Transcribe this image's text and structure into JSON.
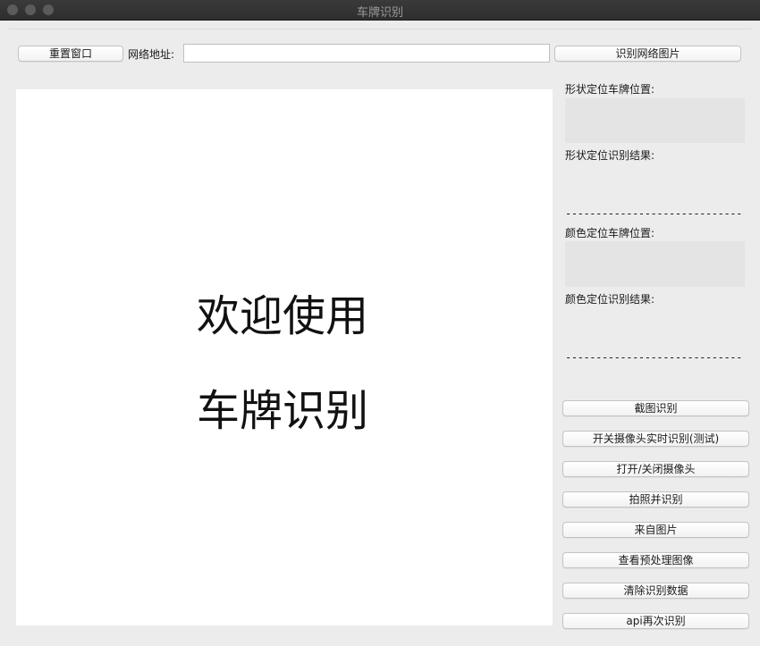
{
  "window": {
    "title": "车牌识别"
  },
  "toolbar": {
    "reset_label": "重置窗口",
    "url_label": "网络地址:",
    "url_value": "",
    "recognize_url_label": "识别网络图片"
  },
  "canvas": {
    "line1": "欢迎使用",
    "line2": "车牌识别"
  },
  "results": {
    "shape_position_label": "形状定位车牌位置:",
    "shape_result_label": "形状定位识别结果:",
    "divider": "---------------------------------",
    "color_position_label": "颜色定位车牌位置:",
    "color_result_label": "颜色定位识别结果:"
  },
  "actions": {
    "items": [
      "截图识别",
      "开关摄像头实时识别(测试)",
      "打开/关闭摄像头",
      "拍照并识别",
      "来自图片",
      "查看预处理图像",
      "清除识别数据",
      "api再次识别"
    ]
  },
  "colors": {
    "titlebar": "#2e2e2e",
    "background": "#ececec",
    "canvas": "#ffffff"
  }
}
